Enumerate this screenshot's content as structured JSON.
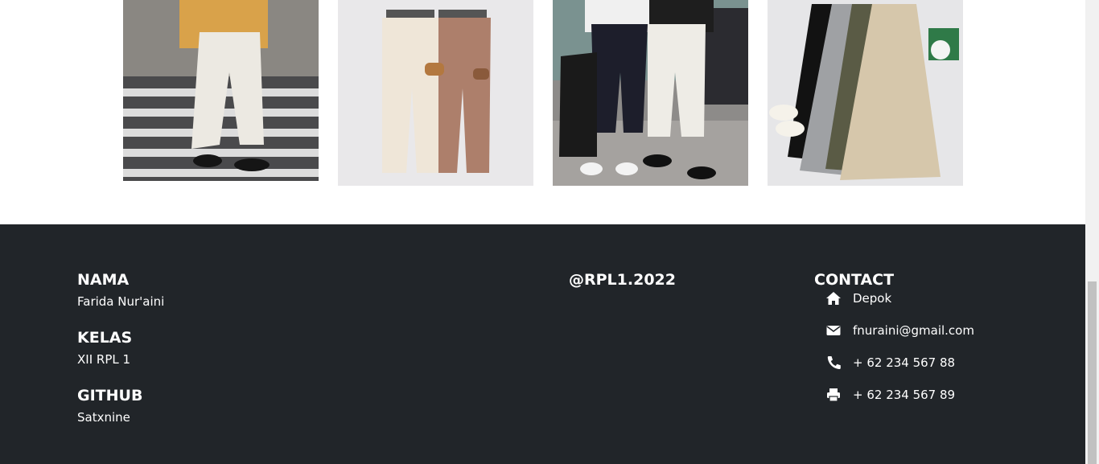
{
  "products": [
    {
      "name": "white-trousers-photo",
      "colors": {
        "bg": "#6e6e6e",
        "main": "#ece9e2",
        "accent": "#d9a24a"
      }
    },
    {
      "name": "cream-brown-trousers-photo",
      "colors": {
        "bg": "#e9e8ea",
        "main": "#efe6d8",
        "accent": "#ad7f6b"
      }
    },
    {
      "name": "black-white-trousers-photo",
      "colors": {
        "bg": "#8d8b89",
        "main": "#1d1e2b",
        "accent": "#eeece6"
      }
    },
    {
      "name": "multicolor-trousers-photo",
      "colors": {
        "bg": "#e6e6e8",
        "main": "#d6c7ab",
        "accent": "#5a5b45"
      }
    }
  ],
  "footer": {
    "background": "#212529",
    "left": {
      "nama_heading": "NAMA",
      "nama_value": "Farida Nur'aini",
      "kelas_heading": "KELAS",
      "kelas_value": "XII RPL 1",
      "github_heading": "GITHUB",
      "github_value": "Satxnine"
    },
    "middle": {
      "handle": "@RPL1.2022"
    },
    "contact": {
      "heading": "CONTACT",
      "items": [
        {
          "icon": "home-icon",
          "text": "Depok"
        },
        {
          "icon": "envelope-icon",
          "text": "fnuraini@gmail.com"
        },
        {
          "icon": "phone-icon",
          "text": "+ 62 234 567 88"
        },
        {
          "icon": "print-icon",
          "text": "+ 62 234 567 89"
        }
      ]
    }
  }
}
